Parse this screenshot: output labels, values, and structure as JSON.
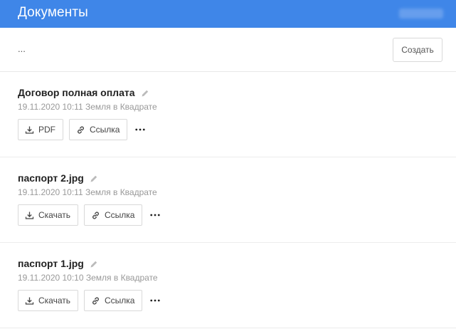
{
  "header": {
    "title": "Документы"
  },
  "toolbar": {
    "path": "...",
    "create_label": "Создать"
  },
  "documents": [
    {
      "title": "Договор полная оплата",
      "meta": "19.11.2020 10:11 Земля в Квадрате",
      "primary_action": "PDF",
      "link_action": "Ссылка"
    },
    {
      "title": "паспорт 2.jpg",
      "meta": "19.11.2020 10:11 Земля в Квадрате",
      "primary_action": "Скачать",
      "link_action": "Ссылка"
    },
    {
      "title": "паспорт 1.jpg",
      "meta": "19.11.2020 10:10 Земля в Квадрате",
      "primary_action": "Скачать",
      "link_action": "Ссылка"
    }
  ],
  "icons": {
    "download": "download-icon",
    "link": "link-icon",
    "edit": "pencil-icon",
    "more": "more-dots-icon"
  },
  "colors": {
    "header_bg": "#3f86e8",
    "meta_text": "#999999",
    "border": "#d9d9d9"
  }
}
